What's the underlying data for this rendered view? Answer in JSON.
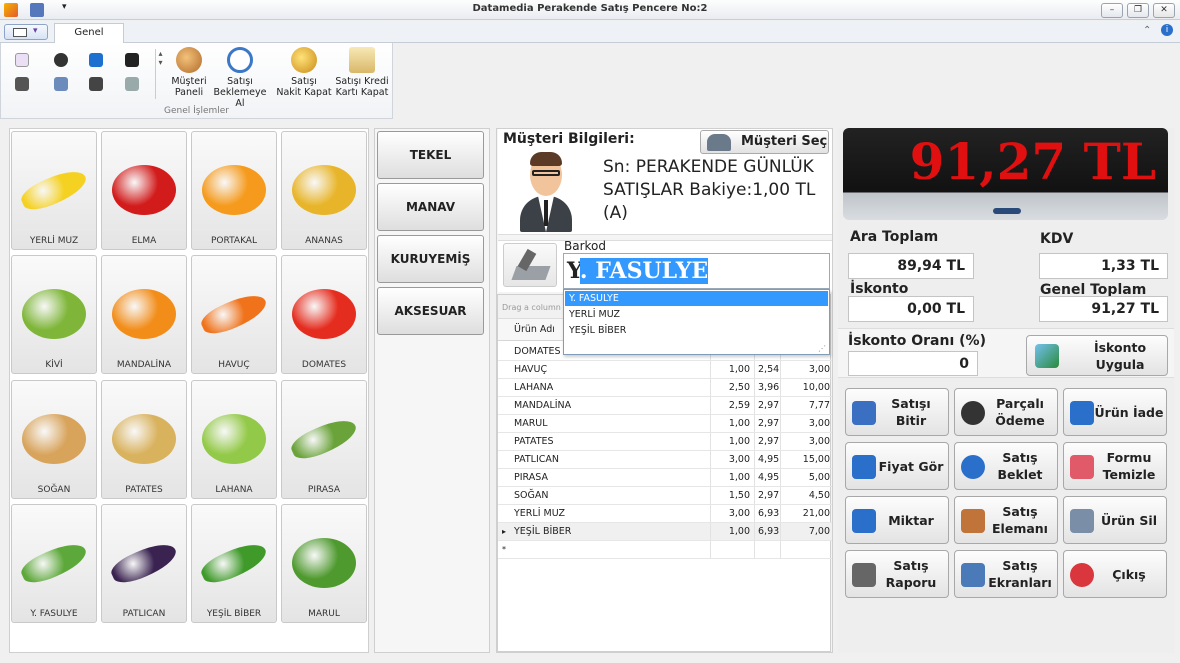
{
  "window": {
    "title": "Datamedia Perakende Satış Pencere No:2"
  },
  "ribbon": {
    "tab": "Genel İşlemler",
    "group_label": "Genel İşlemler",
    "buttons": [
      {
        "label1": "Müşteri",
        "label2": "Paneli"
      },
      {
        "label1": "Satışı",
        "label2": "Beklemeye Al"
      },
      {
        "label1": "Satışı",
        "label2": "Nakit Kapat"
      },
      {
        "label1": "Satışı Kredi",
        "label2": "Kartı Kapat"
      }
    ]
  },
  "products": [
    {
      "name": "YERLİ MUZ",
      "icon": "banana-icon"
    },
    {
      "name": "ELMA",
      "icon": "apple-icon"
    },
    {
      "name": "PORTAKAL",
      "icon": "orange-icon"
    },
    {
      "name": "ANANAS",
      "icon": "pineapple-icon"
    },
    {
      "name": "KİVİ",
      "icon": "kiwi-icon"
    },
    {
      "name": "MANDALİNA",
      "icon": "mandarin-icon"
    },
    {
      "name": "HAVUÇ",
      "icon": "carrot-icon"
    },
    {
      "name": "DOMATES",
      "icon": "tomato-icon"
    },
    {
      "name": "SOĞAN",
      "icon": "onion-icon"
    },
    {
      "name": "PATATES",
      "icon": "potato-icon"
    },
    {
      "name": "LAHANA",
      "icon": "cabbage-icon"
    },
    {
      "name": "PIRASA",
      "icon": "leek-icon"
    },
    {
      "name": "Y. FASULYE",
      "icon": "green-bean-icon"
    },
    {
      "name": "PATLICAN",
      "icon": "eggplant-icon"
    },
    {
      "name": "YEŞİL BİBER",
      "icon": "green-pepper-icon"
    },
    {
      "name": "MARUL",
      "icon": "lettuce-icon"
    }
  ],
  "categories": [
    "TEKEL",
    "MANAV",
    "KURUYEMİŞ",
    "AKSESUAR"
  ],
  "customer": {
    "section_label": "Müşteri Bilgileri:",
    "select_button": "Müşteri Seç",
    "line1": "Sn: PERAKENDE GÜNLÜK",
    "line2": "SATIŞLAR Bakiye:1,00 TL",
    "line3": "(A)"
  },
  "barcode": {
    "label": "Barkod",
    "value_prefix": "Y",
    "value_selected": ". FASULYE",
    "suggestions": [
      "Y. FASULYE",
      "YERLİ MUZ",
      "YEŞİL BİBER"
    ]
  },
  "grid": {
    "group_hint": "Drag a column",
    "header_name": "Ürün Adı",
    "rows": [
      {
        "name": "DOMATES",
        "qty": "",
        "price": "",
        "total": ""
      },
      {
        "name": "HAVUÇ",
        "qty": "1,00",
        "price": "2,54",
        "total": "3,00"
      },
      {
        "name": "LAHANA",
        "qty": "2,50",
        "price": "3,96",
        "total": "10,00"
      },
      {
        "name": "MANDALİNA",
        "qty": "2,59",
        "price": "2,97",
        "total": "7,77"
      },
      {
        "name": "MARUL",
        "qty": "1,00",
        "price": "2,97",
        "total": "3,00"
      },
      {
        "name": "PATATES",
        "qty": "1,00",
        "price": "2,97",
        "total": "3,00"
      },
      {
        "name": "PATLICAN",
        "qty": "3,00",
        "price": "4,95",
        "total": "15,00"
      },
      {
        "name": "PIRASA",
        "qty": "1,00",
        "price": "4,95",
        "total": "5,00"
      },
      {
        "name": "SOĞAN",
        "qty": "1,50",
        "price": "2,97",
        "total": "4,50"
      },
      {
        "name": "YERLİ MUZ",
        "qty": "3,00",
        "price": "6,93",
        "total": "21,00"
      },
      {
        "name": "YEŞİL BİBER",
        "qty": "1,00",
        "price": "6,93",
        "total": "7,00"
      },
      {
        "name": "",
        "qty": "",
        "price": "",
        "total": ""
      }
    ],
    "current_marker": "▸",
    "new_marker": "*"
  },
  "totals": {
    "display": "91,27 TL",
    "ara_toplam_label": "Ara Toplam",
    "ara_toplam": "89,94 TL",
    "kdv_label": "KDV",
    "kdv": "1,33 TL",
    "iskonto_label": "İskonto",
    "iskonto": "0,00 TL",
    "genel_toplam_label": "Genel Toplam",
    "genel_toplam": "91,27 TL",
    "iskonto_orani_label": "İskonto Oranı (%)",
    "iskonto_orani": "0",
    "iskonto_uygula": "İskonto Uygula"
  },
  "actions": [
    {
      "label": "Satışı Bitir",
      "icon": "checklist-icon"
    },
    {
      "label": "Parçalı Ödeme",
      "icon": "coins-icon"
    },
    {
      "label": "Ürün İade",
      "icon": "return-arrow-icon"
    },
    {
      "label": "Fiyat Gör",
      "icon": "price-tag-icon"
    },
    {
      "label": "Satış Beklet",
      "icon": "clock-icon"
    },
    {
      "label": "Formu Temizle",
      "icon": "eraser-icon"
    },
    {
      "label": "Miktar",
      "icon": "numbers-icon"
    },
    {
      "label": "Satış Elemanı",
      "icon": "salesperson-icon"
    },
    {
      "label": "Ürün Sil",
      "icon": "delete-row-icon"
    },
    {
      "label": "Satış Raporu",
      "icon": "printer-icon"
    },
    {
      "label": "Satış Ekranları",
      "icon": "screens-icon"
    },
    {
      "label": "Çıkış",
      "icon": "exit-icon"
    }
  ],
  "colors": {
    "display_text": "#e01010",
    "selection": "#3399ff",
    "accent": "#1e88d8"
  }
}
